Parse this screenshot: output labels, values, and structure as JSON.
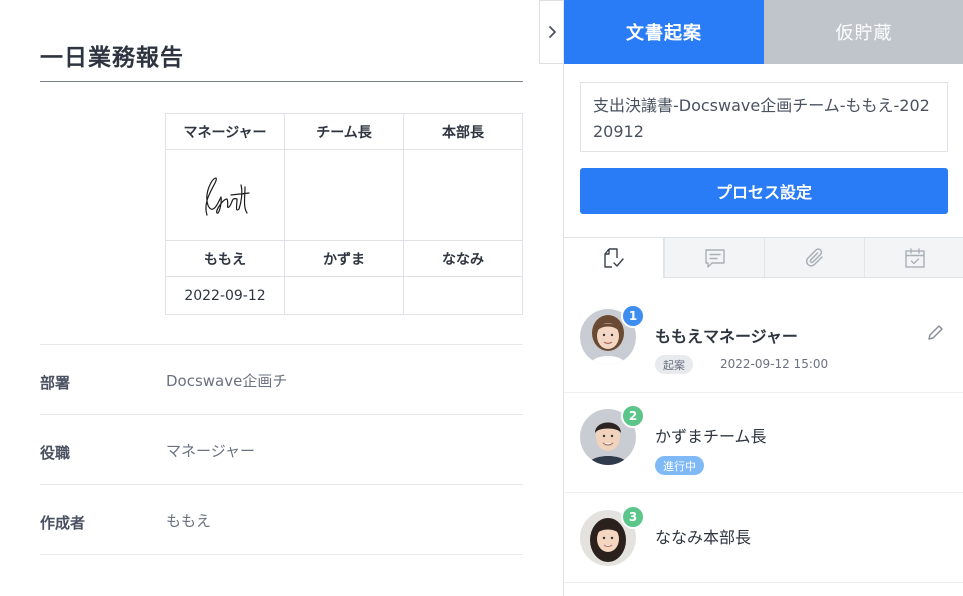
{
  "document": {
    "title": "一日業務報告",
    "approval": {
      "headers": [
        "マネージャー",
        "チーム長",
        "本部長"
      ],
      "names": [
        "ももえ",
        "かずま",
        "ななみ"
      ],
      "dates": [
        "2022-09-12",
        "",
        ""
      ]
    },
    "fields": [
      {
        "label": "部署",
        "value": "Docswave企画チ"
      },
      {
        "label": "役職",
        "value": "マネージャー"
      },
      {
        "label": "作成者",
        "value": "ももえ"
      }
    ]
  },
  "panel": {
    "tabs": {
      "draft": "文書起案",
      "temp_save": "仮貯蔵"
    },
    "doc_name": "支出決議書-Docswave企画チーム-ももえ-20220912",
    "process_button": "プロセス設定",
    "icon_tabs": [
      "document-check-icon",
      "comment-icon",
      "paperclip-icon",
      "calendar-check-icon"
    ],
    "approvers": [
      {
        "number": "1",
        "name": "ももえマネージャー",
        "status": "起案",
        "time": "2022-09-12 15:00",
        "color": "#3d8ef0"
      },
      {
        "number": "2",
        "name": "かずまチーム長",
        "status": "進行中",
        "time": "",
        "color": "#5cc58a"
      },
      {
        "number": "3",
        "name": "ななみ本部長",
        "status": "",
        "time": "",
        "color": "#5cc58a"
      }
    ]
  },
  "colors": {
    "accent": "#2a7cf6",
    "tab_inactive": "#c0c5cc",
    "badge_progress": "#7fb9f6"
  }
}
